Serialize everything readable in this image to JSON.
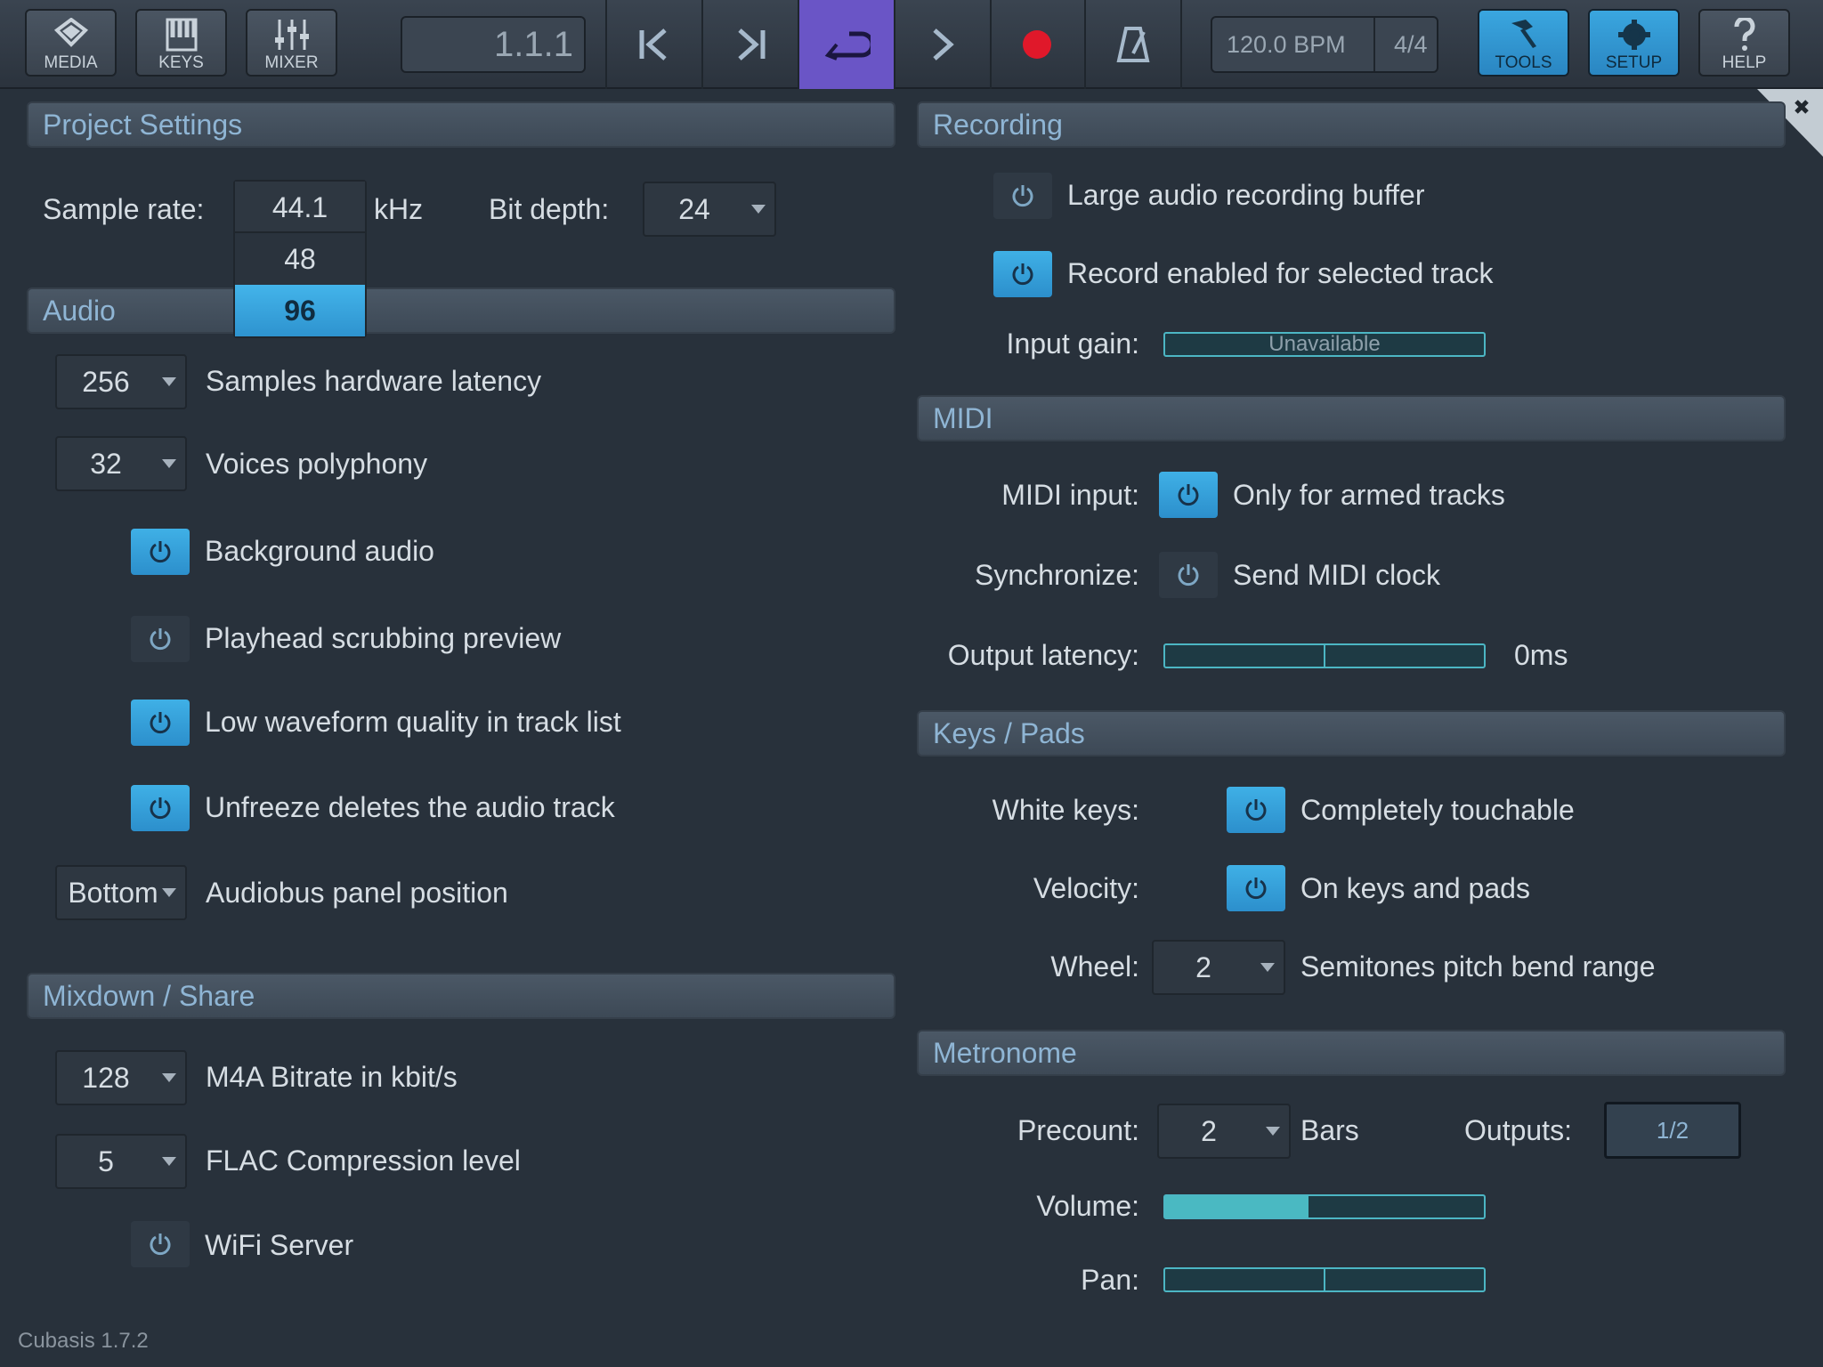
{
  "toolbar": {
    "media_label": "MEDIA",
    "keys_label": "KEYS",
    "mixer_label": "MIXER",
    "position": "1.1.1",
    "tempo": "120.0 BPM",
    "time_signature": "4/4",
    "tools_label": "TOOLS",
    "setup_label": "SETUP",
    "help_label": "HELP",
    "active_color": "#6a55c6",
    "accent_color": "#3aa6df",
    "record_color": "#e0182a"
  },
  "project_settings": {
    "title": "Project Settings",
    "sample_rate_label": "Sample rate:",
    "sample_rate_value": "44.1",
    "sample_rate_unit": "kHz",
    "sample_rate_options": [
      "48",
      "96"
    ],
    "bit_depth_label": "Bit depth:",
    "bit_depth_value": "24"
  },
  "audio": {
    "title": "Audio",
    "latency_value": "256",
    "latency_label": "Samples hardware latency",
    "polyphony_value": "32",
    "polyphony_label": "Voices polyphony",
    "background_audio_label": "Background audio",
    "background_audio_on": true,
    "scrubbing_label": "Playhead scrubbing preview",
    "scrubbing_on": false,
    "waveform_label": "Low waveform quality in track list",
    "waveform_on": true,
    "unfreeze_label": "Unfreeze deletes the audio track",
    "unfreeze_on": true,
    "audiobus_value": "Bottom",
    "audiobus_label": "Audiobus panel position"
  },
  "mixdown": {
    "title": "Mixdown / Share",
    "bitrate_value": "128",
    "bitrate_label": "M4A Bitrate in kbit/s",
    "flac_value": "5",
    "flac_label": "FLAC Compression level",
    "wifi_label": "WiFi Server",
    "wifi_on": false
  },
  "recording": {
    "title": "Recording",
    "buffer_label": "Large audio recording buffer",
    "buffer_on": false,
    "record_enabled_label": "Record enabled for selected track",
    "record_enabled_on": true,
    "input_gain_label": "Input gain:",
    "input_gain_value": "Unavailable"
  },
  "midi": {
    "title": "MIDI",
    "input_label": "MIDI input:",
    "input_value": "Only for armed tracks",
    "input_on": true,
    "sync_label": "Synchronize:",
    "sync_value": "Send MIDI clock",
    "sync_on": false,
    "output_latency_label": "Output latency:",
    "output_latency_value": "0ms"
  },
  "keys_pads": {
    "title": "Keys / Pads",
    "white_keys_label": "White keys:",
    "white_keys_value": "Completely touchable",
    "white_keys_on": true,
    "velocity_label": "Velocity:",
    "velocity_value": "On keys and pads",
    "velocity_on": true,
    "wheel_label": "Wheel:",
    "wheel_value": "2",
    "wheel_desc": "Semitones pitch bend range"
  },
  "metronome": {
    "title": "Metronome",
    "precount_label": "Precount:",
    "precount_value": "2",
    "precount_unit": "Bars",
    "outputs_label": "Outputs:",
    "outputs_value": "1/2",
    "volume_label": "Volume:",
    "volume_level": 0.45,
    "pan_label": "Pan:",
    "pan_level": 0.5
  },
  "footer": {
    "version": "Cubasis 1.7.2"
  }
}
